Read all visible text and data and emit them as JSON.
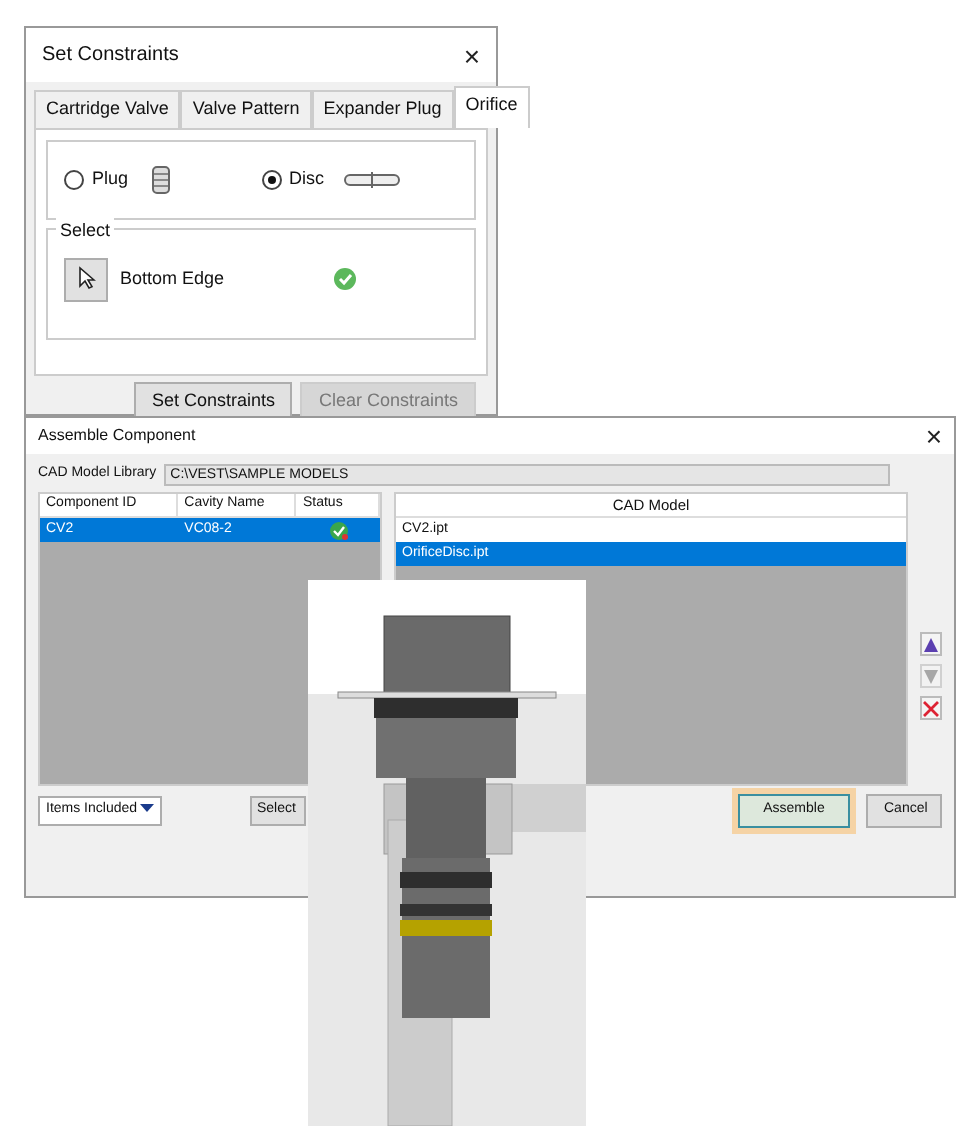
{
  "constraints_dialog": {
    "title": "Set Constraints",
    "close": "×",
    "tabs": [
      {
        "label": "Cartridge Valve",
        "selected": false
      },
      {
        "label": "Valve Pattern",
        "selected": false
      },
      {
        "label": "Expander Plug",
        "selected": false
      },
      {
        "label": "Orifice",
        "selected": true
      }
    ],
    "options": [
      {
        "label": "Plug",
        "kind": "plug",
        "selected": false
      },
      {
        "label": "Disc",
        "kind": "disc",
        "selected": true
      }
    ],
    "select_group": {
      "title": "Select",
      "item": "Bottom Edge",
      "valid": true
    },
    "buttons": [
      {
        "label": "Set Constraints",
        "disabled": false
      },
      {
        "label": "Clear Constraints",
        "disabled": true
      }
    ]
  },
  "assemble_dialog": {
    "title": "Assemble Component",
    "close": "×",
    "library_label": "CAD Model Library",
    "library_path": "C:\\VEST\\SAMPLE MODELS",
    "components": {
      "columns": [
        "Component ID",
        "Cavity Name",
        "Status"
      ],
      "rows": [
        {
          "cells": [
            "CV2",
            "VC08-2"
          ],
          "status_ok": true,
          "selected": true
        }
      ]
    },
    "models": {
      "column": "CAD Model",
      "rows": [
        {
          "label": "CV2.ipt",
          "selected": false
        },
        {
          "label": "OrificeDisc.ipt",
          "selected": true
        }
      ]
    },
    "side_buttons": [
      {
        "kind": "up",
        "disabled": false
      },
      {
        "kind": "down",
        "disabled": true
      },
      {
        "kind": "delete",
        "disabled": false
      }
    ],
    "items_button": "Items Included",
    "select_button": "Select",
    "buttons": [
      {
        "label": "Assemble",
        "focused": true
      },
      {
        "label": "Cancel",
        "focused": false
      }
    ]
  }
}
